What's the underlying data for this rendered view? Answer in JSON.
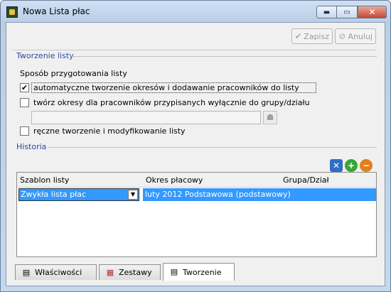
{
  "window": {
    "title": "Nowa Lista płac",
    "min_glyph": "▬",
    "max_glyph": "▭",
    "close_glyph": "✕"
  },
  "toolbar": {
    "save_label": "Zapisz",
    "cancel_label": "Anuluj",
    "save_icon": "✔",
    "cancel_icon": "⊘"
  },
  "creation": {
    "group_title": "Tworzenie listy",
    "method_label": "Sposób przygotowania listy",
    "options": [
      {
        "label": "automatyczne tworzenie okresów i dodawanie pracowników do listy",
        "checked": true
      },
      {
        "label": "twórz okresy dla pracowników przypisanych wyłącznie do grupy/działu",
        "checked": false
      },
      {
        "label": "ręczne tworzenie i modyfikowanie listy",
        "checked": false
      }
    ],
    "group_input_value": ""
  },
  "history": {
    "group_title": "Historia",
    "columns": [
      "Szablon listy",
      "Okres płacowy",
      "Grupa/Dział"
    ],
    "rows": [
      {
        "template": "Zwykła lista płac",
        "period": "luty 2012 Podstawowa (podstawowy)",
        "group": ""
      }
    ]
  },
  "tabs": [
    {
      "label": "Właściwości",
      "icon": "▤"
    },
    {
      "label": "Zestawy",
      "icon": "▦"
    },
    {
      "label": "Tworzenie",
      "icon": "▤",
      "active": true
    }
  ],
  "colors": {
    "accent": "#3399ff",
    "group_title": "#2c4a9e"
  }
}
